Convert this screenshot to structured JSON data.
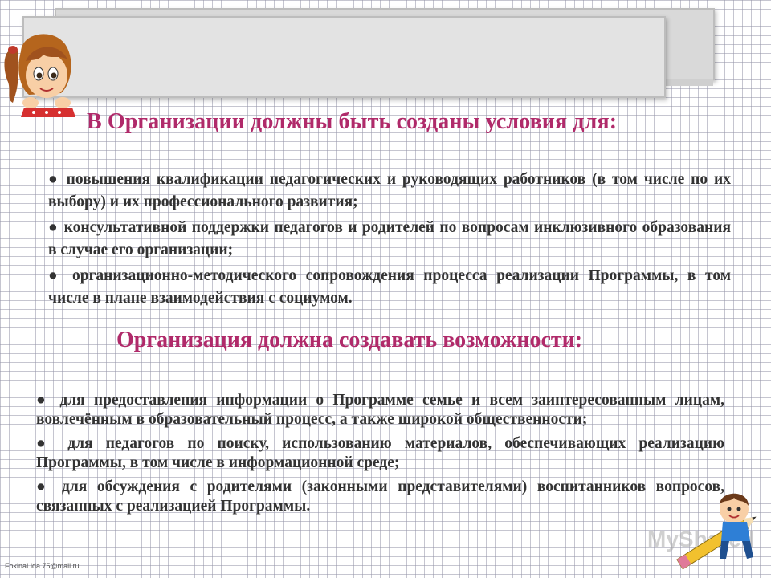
{
  "heading_1": "В Организации должны быть созданы условия для:",
  "conditions": [
    "● повышения квалификации педагогических и руководящих работников (в том числе по их выбору) и их профессионального развития;",
    "● консультативной поддержки педагогов и родителей по вопросам инклюзивного образования в случае его организации;",
    "● организационно-методического сопровождения процесса реализации Программы, в том числе в плане взаимодействия с социумом."
  ],
  "heading_2": "Организация должна создавать возможности:",
  "opportunities": [
    "● для предоставления информации о Программе семье и всем заинтересованным лицам, вовлечённым в образовательный процесс, а также широкой общественности;",
    "● для педагогов по поиску, использованию материалов, обеспечивающих реализацию Программы, в том числе в информационной среде;",
    "● для обсуждения с родителями (законными представителями) воспитанников вопросов, связанных с реализацией Программы."
  ],
  "footer_email": "FokinaLida.75@mail.ru",
  "watermark": "MyShared",
  "colors": {
    "heading": "#b02a6a",
    "body_text": "#333333",
    "panel": "#e3e3e3"
  },
  "icons": {
    "girl": "cartoon-girl-illustration",
    "boy": "cartoon-boy-with-pencil-illustration"
  }
}
